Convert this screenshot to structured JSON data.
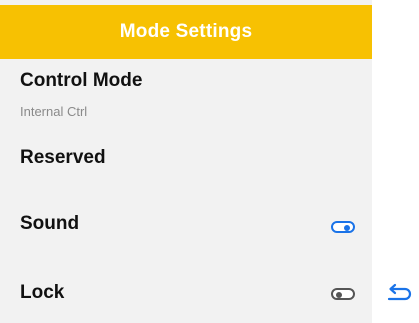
{
  "header": {
    "title": "Mode Settings"
  },
  "rows": [
    {
      "label": "Control Mode",
      "sublabel": "Internal Ctrl"
    },
    {
      "label": "Reserved"
    },
    {
      "label": "Sound",
      "toggle": {
        "state": "on"
      }
    },
    {
      "label": "Lock",
      "toggle": {
        "state": "off"
      }
    }
  ],
  "colors": {
    "header": "#f7c102",
    "panel": "#f2f2f2",
    "accent": "#1a73e8",
    "toggle_off": "#555555"
  },
  "icons": {
    "back": "return-arrow-icon"
  }
}
